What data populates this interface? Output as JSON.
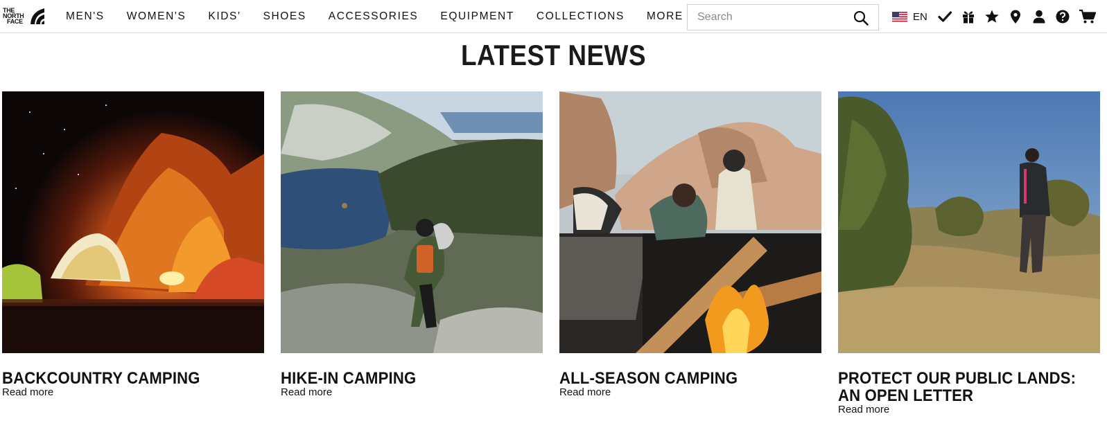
{
  "brand": {
    "logo_line1": "THE",
    "logo_line2": "NORTH",
    "logo_line3": "FACE"
  },
  "nav": {
    "items": [
      {
        "label": "MEN'S"
      },
      {
        "label": "WOMEN'S"
      },
      {
        "label": "KIDS'"
      },
      {
        "label": "SHOES"
      },
      {
        "label": "ACCESSORIES"
      },
      {
        "label": "EQUIPMENT"
      },
      {
        "label": "COLLECTIONS"
      },
      {
        "label": "MORE"
      }
    ]
  },
  "search": {
    "placeholder": "Search",
    "value": "",
    "icon": "search-icon"
  },
  "utilities": {
    "language": "EN",
    "flag_icon": "us-flag-icon",
    "icons": [
      "checkmark-icon",
      "gift-icon",
      "star-icon",
      "location-pin-icon",
      "user-icon",
      "help-icon",
      "cart-icon"
    ]
  },
  "main": {
    "section_title": "LATEST NEWS",
    "articles": [
      {
        "title": "BACKCOUNTRY CAMPING",
        "link_label": "Read more",
        "image_subject": "night campsite tents glowing beneath orange rocks"
      },
      {
        "title": "HIKE-IN CAMPING",
        "link_label": "Read more",
        "image_subject": "hiker climbing granite slope above mountain lake"
      },
      {
        "title": "ALL-SEASON CAMPING",
        "link_label": "Read more",
        "image_subject": "two campers tending a campfire among boulders"
      },
      {
        "title": "PROTECT OUR PUBLIC LANDS: AN OPEN LETTER",
        "link_label": "Read more",
        "image_subject": "hiker walking through desert scrubland"
      }
    ]
  },
  "colors": {
    "text": "#111111",
    "border": "#d9d9d9",
    "background": "#ffffff"
  }
}
